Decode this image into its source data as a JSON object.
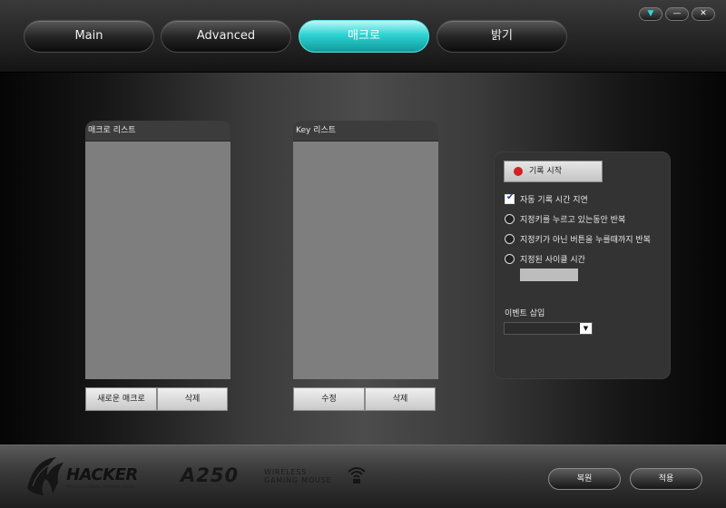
{
  "window": {
    "controls": {
      "help": "▼",
      "minimize": "—",
      "close": "✕"
    }
  },
  "tabs": [
    {
      "label": "Main"
    },
    {
      "label": "Advanced"
    },
    {
      "label": "매크로",
      "active": true
    },
    {
      "label": "밝기"
    }
  ],
  "macro_list": {
    "title": "매크로 리스트",
    "new_button": "새로운 매크로",
    "delete_button": "삭제"
  },
  "key_list": {
    "title": "Key 리스트",
    "edit_button": "수정",
    "delete_button": "삭제"
  },
  "record_panel": {
    "record_button": "기록 시작",
    "options": [
      {
        "type": "checkbox",
        "checked": true,
        "label": "자동 기록 시간 지연"
      },
      {
        "type": "radio",
        "checked": false,
        "label": "지정키를 누르고 있는동안 반복"
      },
      {
        "type": "radio",
        "checked": false,
        "label": "지정키가 아닌 버튼을 누를때까지 반복"
      },
      {
        "type": "radio",
        "checked": false,
        "label": "지정된 사이클 시간"
      }
    ],
    "cycle_time_value": "",
    "event_insert_label": "이벤트 삽입",
    "event_insert_value": ""
  },
  "footer": {
    "brand": "HACKER",
    "brand_tagline": "PROFESSIONAL GAMING GEAR",
    "model": "A250",
    "model_line1": "WIRELESS",
    "model_line2": "GAMING MOUSE",
    "restore_button": "복원",
    "apply_button": "적용"
  },
  "colors": {
    "accent": "#2ed3d3",
    "record_dot": "#d32020",
    "panel_fill": "#7e7e7e"
  }
}
